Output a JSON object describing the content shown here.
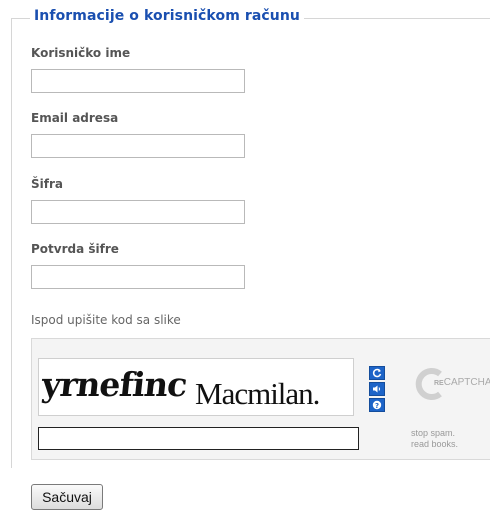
{
  "form": {
    "legend": "Informacije o korisničkom računu",
    "fields": [
      {
        "label": "Korisničko ime",
        "value": ""
      },
      {
        "label": "Email adresa",
        "value": ""
      },
      {
        "label": "Šifra",
        "value": ""
      },
      {
        "label": "Potvrda šifre",
        "value": ""
      }
    ],
    "save_label": "Sačuvaj"
  },
  "captcha": {
    "prompt": "Ispod upišite kod sa slike",
    "word1": "yrnefinc",
    "word2": "Macmilan.",
    "input_value": "",
    "brand_re": "RE",
    "brand_name": "CAPTCHA™",
    "tagline_1": "stop spam.",
    "tagline_2": "read books.",
    "controls": [
      "refresh-icon",
      "audio-icon",
      "help-icon"
    ]
  },
  "colors": {
    "legend": "#1a4fb0",
    "captcha_button": "#1d64c8",
    "captcha_bg": "#f4f4f4"
  }
}
